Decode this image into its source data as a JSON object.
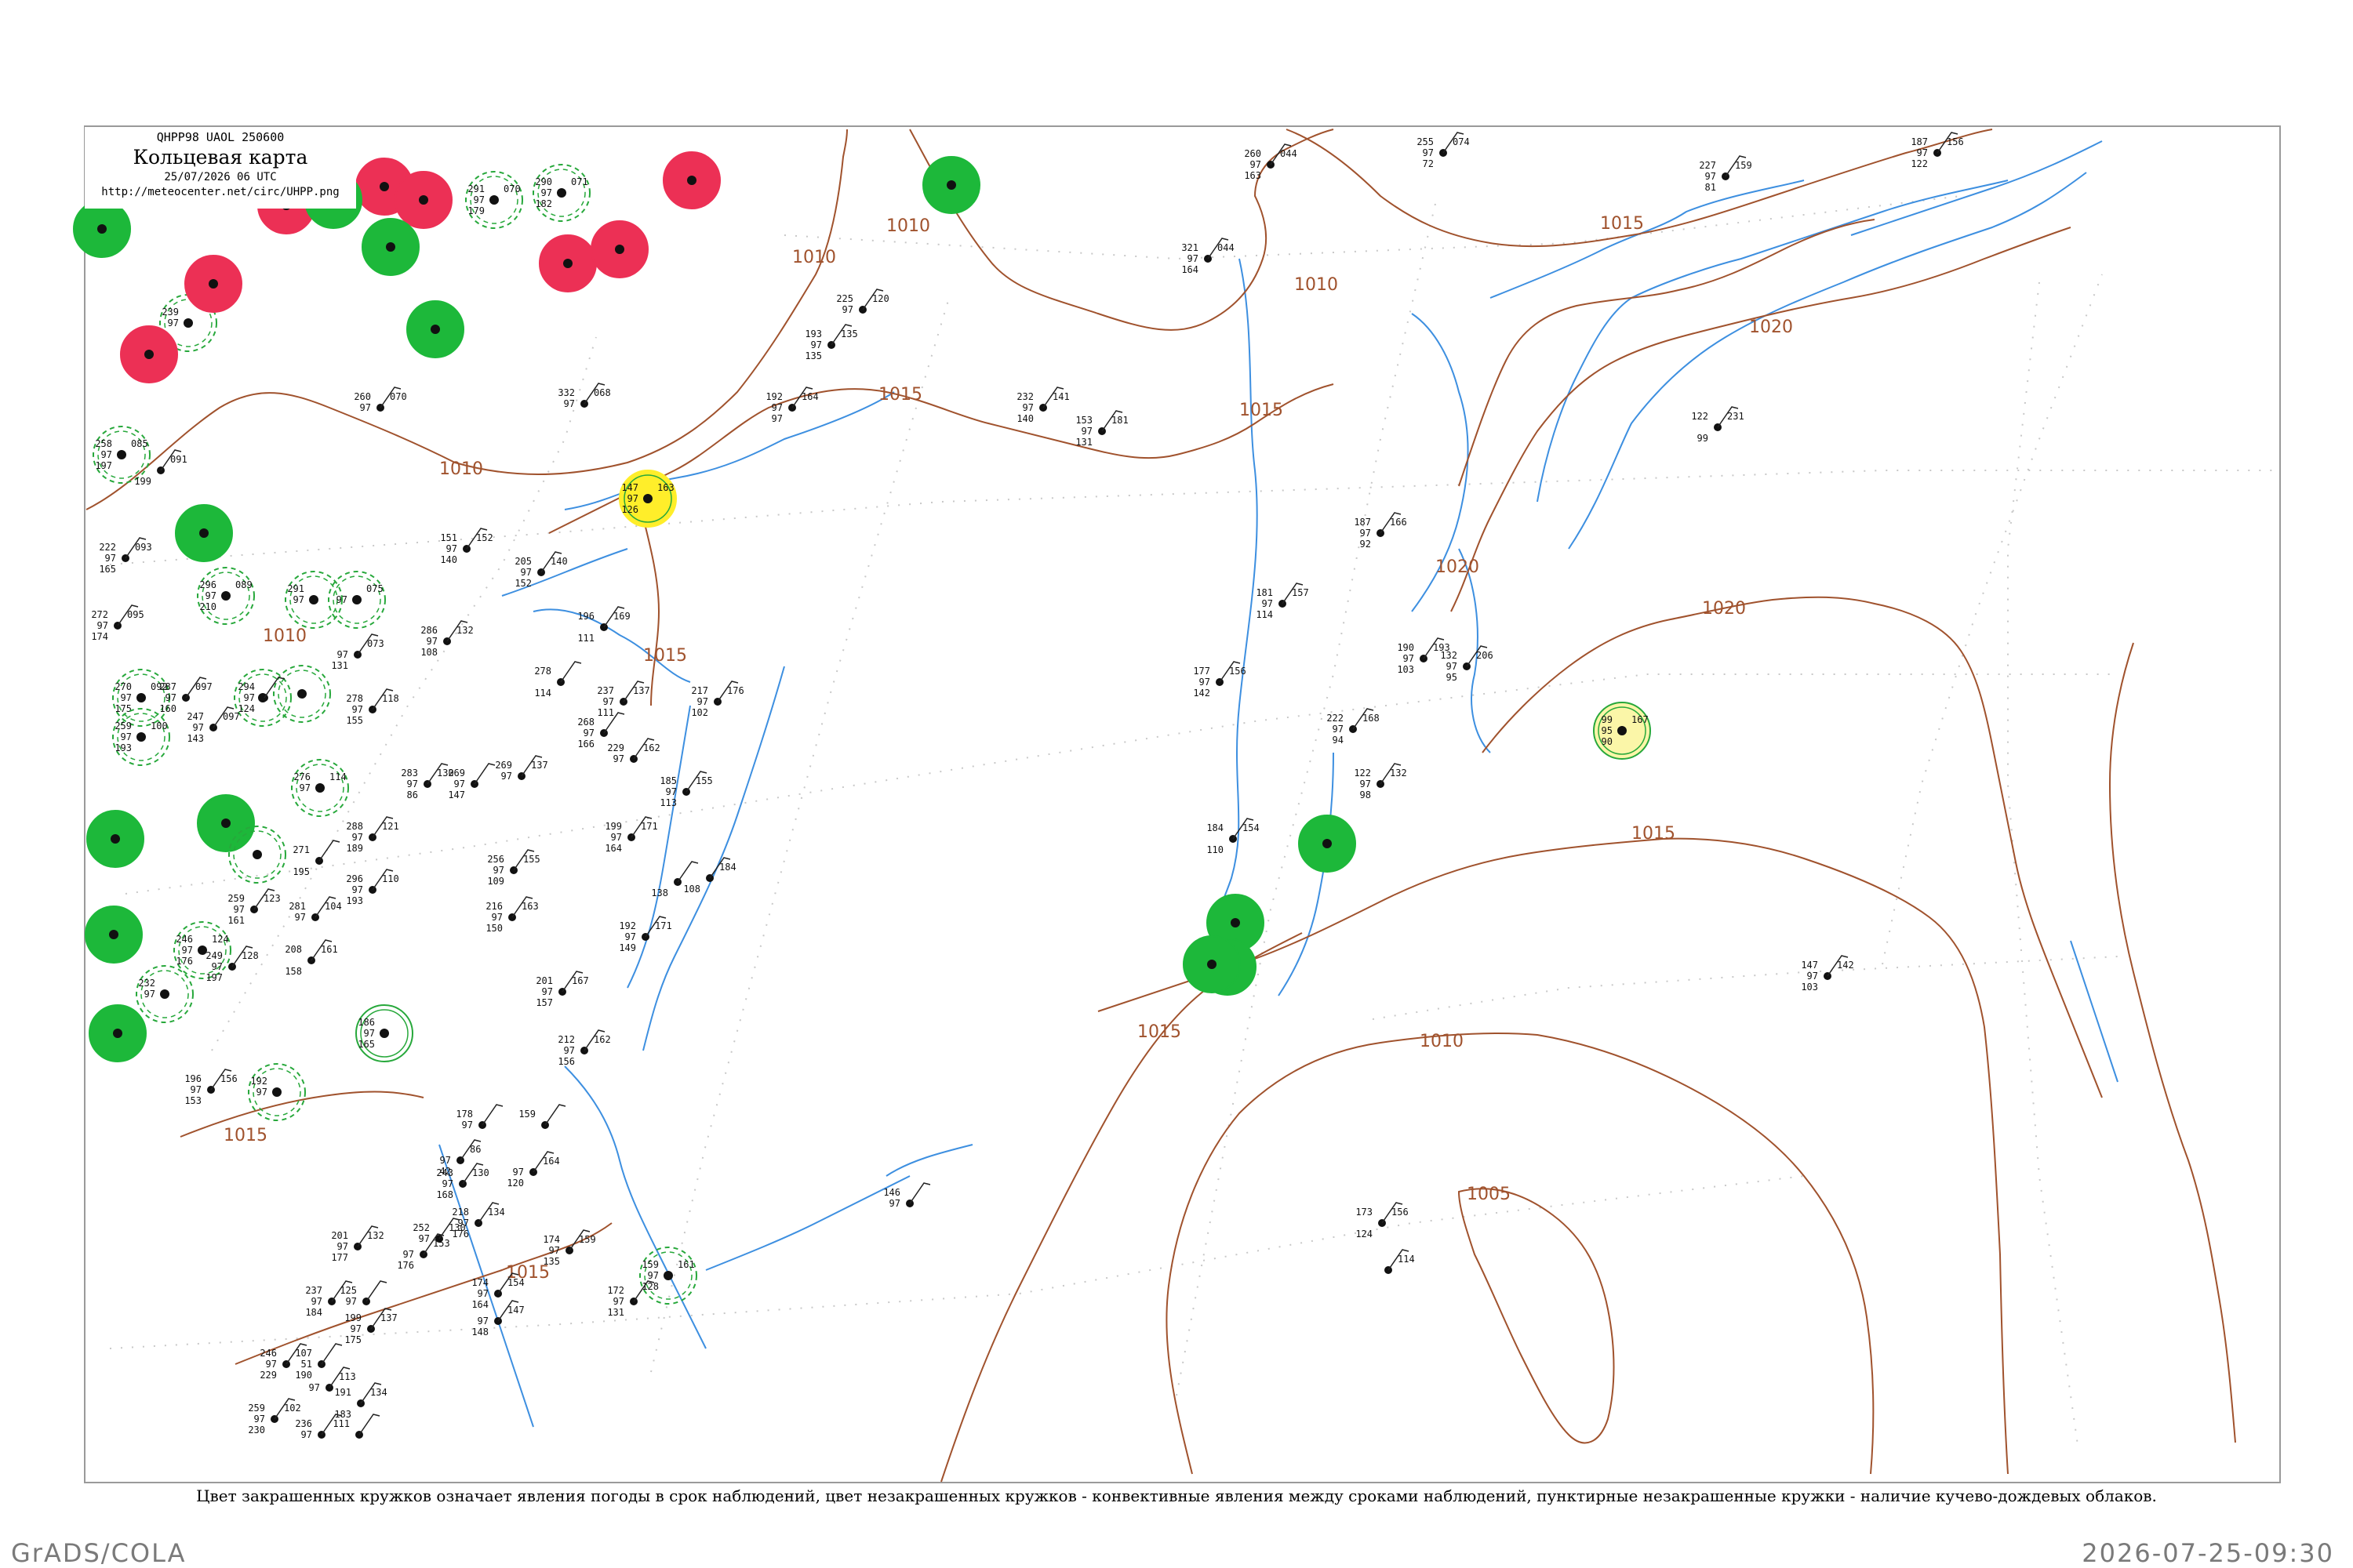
{
  "header": {
    "code": "QHPP98  UAOL  250600",
    "title": "Кольцевая карта",
    "date": "25/07/2026 06 UTC",
    "url": "http://meteocenter.net/circ/UHPP.png"
  },
  "caption": "Цвет закрашенных кружков означает явления погоды в срок наблюдений, цвет незакрашенных кружков - конвективные явления между сроками наблюдений, пунктирные незакрашенные кружки - наличие кучево-дождевых облаков.",
  "footer": {
    "left": "GrADS/COLA",
    "right": "2026-07-25-09:30"
  },
  "colors": {
    "isobar": "#a0522d",
    "water": "#3d8fe0",
    "green": "#1db83a",
    "red": "#ec3055",
    "yellow": "#ffee2a",
    "dashed": "#27a83b",
    "grid": "#c8c8c8",
    "frame": "#9a9a9a"
  },
  "isobar_labels": [
    {
      "text": "1010"
    },
    {
      "text": "1010"
    },
    {
      "text": "1010"
    },
    {
      "text": "1010"
    },
    {
      "text": "1015"
    },
    {
      "text": "1015"
    },
    {
      "text": "1015"
    },
    {
      "text": "1015"
    },
    {
      "text": "1020"
    },
    {
      "text": "1020"
    },
    {
      "text": "1020"
    },
    {
      "text": "1015"
    },
    {
      "text": "1015"
    },
    {
      "text": "1010"
    },
    {
      "text": "1005"
    },
    {
      "text": "1015"
    },
    {
      "text": "1015"
    },
    {
      "text": "1010"
    }
  ],
  "stations": [
    {
      "pr": "",
      "t": "",
      "td": "",
      "p3": "",
      "mark": "green-fill"
    },
    {
      "pr": "",
      "t": "",
      "td": "",
      "p3": "",
      "mark": "red-fill"
    },
    {
      "pr": "",
      "t": "",
      "td": "",
      "p3": "",
      "mark": "red-fill"
    },
    {
      "pr": "",
      "t": "",
      "td": "",
      "p3": "",
      "mark": "red-fill"
    },
    {
      "pr": "",
      "t": "",
      "td": "",
      "p3": "",
      "mark": "green-fill"
    },
    {
      "pr": "",
      "t": "",
      "td": "",
      "p3": "",
      "mark": "green-fill"
    },
    {
      "pr": "290",
      "t": "97",
      "td": "182",
      "p3": "071",
      "mark": "green-dash"
    },
    {
      "pr": "291",
      "t": "97",
      "td": "179",
      "p3": "070",
      "mark": "green-dash"
    },
    {
      "pr": "",
      "t": "",
      "td": "",
      "p3": "",
      "mark": "red-fill"
    },
    {
      "pr": "",
      "t": "",
      "td": "",
      "p3": "",
      "mark": "red-fill"
    },
    {
      "pr": "",
      "t": "",
      "td": "",
      "p3": "",
      "mark": "red-fill"
    },
    {
      "pr": "",
      "t": "",
      "td": "",
      "p3": "",
      "mark": "green-fill"
    },
    {
      "pr": "239",
      "t": "97",
      "td": "",
      "p3": "",
      "mark": "green-dash"
    },
    {
      "pr": "",
      "t": "",
      "td": "",
      "p3": "",
      "mark": "red-fill"
    },
    {
      "pr": "",
      "t": "",
      "td": "",
      "p3": "",
      "mark": "red-fill"
    },
    {
      "pr": "",
      "t": "",
      "td": "",
      "p3": "",
      "mark": "green-fill"
    },
    {
      "pr": "147",
      "t": "97",
      "td": "126",
      "p3": "163",
      "mark": "yellow-fill"
    },
    {
      "pr": "258",
      "t": "97",
      "td": "197",
      "p3": "085",
      "mark": "green-dash"
    },
    {
      "pr": "",
      "t": "",
      "td": "",
      "p3": "",
      "mark": "green-fill"
    },
    {
      "pr": "296",
      "t": "97",
      "td": "210",
      "p3": "089",
      "mark": "green-dash"
    },
    {
      "pr": "291",
      "t": "97",
      "td": "",
      "p3": "",
      "mark": "green-dash"
    },
    {
      "pr": "",
      "t": "97",
      "td": "",
      "p3": "075",
      "mark": "green-dash"
    },
    {
      "pr": "270",
      "t": "97",
      "td": "175",
      "p3": "092",
      "mark": "green-dash"
    },
    {
      "pr": "259",
      "t": "97",
      "td": "193",
      "p3": "100",
      "mark": "green-dash"
    },
    {
      "pr": "",
      "t": "",
      "td": "",
      "p3": "",
      "mark": "green-dash"
    },
    {
      "pr": "",
      "t": "",
      "td": "",
      "p3": "",
      "mark": "green-dash"
    },
    {
      "pr": "276",
      "t": "97",
      "td": "",
      "p3": "114",
      "mark": "green-dash"
    },
    {
      "pr": "",
      "t": "",
      "td": "",
      "p3": "",
      "mark": "green-fill"
    },
    {
      "pr": "",
      "t": "",
      "td": "",
      "p3": "",
      "mark": "green-fill"
    },
    {
      "pr": "",
      "t": "",
      "td": "",
      "p3": "",
      "mark": "green-dash"
    },
    {
      "pr": "",
      "t": "",
      "td": "",
      "p3": "",
      "mark": "green-fill"
    },
    {
      "pr": "246",
      "t": "97",
      "td": "176",
      "p3": "124",
      "mark": "green-dash"
    },
    {
      "pr": "232",
      "t": "97",
      "td": "",
      "p3": "",
      "mark": "green-dash"
    },
    {
      "pr": "",
      "t": "",
      "td": "",
      "p3": "",
      "mark": "green-fill"
    },
    {
      "pr": "186",
      "t": "97",
      "td": "165",
      "p3": "",
      "mark": "green-ring"
    },
    {
      "pr": "192",
      "t": "97",
      "td": "",
      "p3": "",
      "mark": "green-dash"
    },
    {
      "pr": "",
      "t": "",
      "td": "",
      "p3": "",
      "mark": "green-fill"
    },
    {
      "pr": "",
      "t": "",
      "td": "",
      "p3": "",
      "mark": "green-fill"
    },
    {
      "pr": "",
      "t": "",
      "td": "",
      "p3": "",
      "mark": "green-fill"
    },
    {
      "pr": "",
      "t": "",
      "td": "",
      "p3": "",
      "mark": "green-fill"
    },
    {
      "pr": "99",
      "t": "95",
      "td": "90",
      "p3": "167",
      "mark": "yellow-ring"
    },
    {
      "pr": "159",
      "t": "97",
      "td": "128",
      "p3": "161",
      "mark": "green-dash"
    }
  ],
  "plain_stations": [
    {
      "pr": "260",
      "t": "97",
      "td": "163",
      "p3": "044"
    },
    {
      "pr": "321",
      "t": "97",
      "td": "164",
      "p3": "044"
    },
    {
      "pr": "255",
      "t": "97",
      "td": "72",
      "p3": "074"
    },
    {
      "pr": "227",
      "t": "97",
      "td": "81",
      "p3": "159"
    },
    {
      "pr": "187",
      "t": "97",
      "td": "122",
      "p3": "156"
    },
    {
      "pr": "225",
      "t": "97",
      "td": "",
      "p3": "120"
    },
    {
      "pr": "193",
      "t": "97",
      "td": "135",
      "p3": "135"
    },
    {
      "pr": "192",
      "t": "97",
      "td": "97",
      "p3": "164"
    },
    {
      "pr": "232",
      "t": "97",
      "td": "140",
      "p3": "141"
    },
    {
      "pr": "153",
      "t": "97",
      "td": "131",
      "p3": "181"
    },
    {
      "pr": "122",
      "t": "",
      "td": "99",
      "p3": "231"
    },
    {
      "pr": "260",
      "t": "97",
      "td": "",
      "p3": "070"
    },
    {
      "pr": "332",
      "t": "97",
      "td": "",
      "p3": "068"
    },
    {
      "pr": "",
      "t": "",
      "td": "199",
      "p3": "091"
    },
    {
      "pr": "151",
      "t": "97",
      "td": "140",
      "p3": "152"
    },
    {
      "pr": "205",
      "t": "97",
      "td": "152",
      "p3": "140"
    },
    {
      "pr": "187",
      "t": "97",
      "td": "92",
      "p3": "166"
    },
    {
      "pr": "181",
      "t": "97",
      "td": "114",
      "p3": "157"
    },
    {
      "pr": "190",
      "t": "97",
      "td": "103",
      "p3": "193"
    },
    {
      "pr": "132",
      "t": "97",
      "td": "95",
      "p3": "206"
    },
    {
      "pr": "177",
      "t": "97",
      "td": "142",
      "p3": "156"
    },
    {
      "pr": "222",
      "t": "97",
      "td": "94",
      "p3": "168"
    },
    {
      "pr": "122",
      "t": "97",
      "td": "98",
      "p3": "132"
    },
    {
      "pr": "184",
      "t": "",
      "td": "110",
      "p3": "154"
    },
    {
      "pr": "222",
      "t": "97",
      "td": "165",
      "p3": "093"
    },
    {
      "pr": "272",
      "t": "97",
      "td": "174",
      "p3": "095"
    },
    {
      "pr": "286",
      "t": "97",
      "td": "108",
      "p3": "132"
    },
    {
      "pr": "",
      "t": "97",
      "td": "131",
      "p3": "073"
    },
    {
      "pr": "278",
      "t": "",
      "td": "114",
      "p3": ""
    },
    {
      "pr": "196",
      "t": "",
      "td": "111",
      "p3": "169"
    },
    {
      "pr": "237",
      "t": "97",
      "td": "111",
      "p3": "137"
    },
    {
      "pr": "217",
      "t": "97",
      "td": "102",
      "p3": "176"
    },
    {
      "pr": "287",
      "t": "97",
      "td": "160",
      "p3": "097"
    },
    {
      "pr": "294",
      "t": "97",
      "td": "124",
      "p3": ""
    },
    {
      "pr": "278",
      "t": "97",
      "td": "155",
      "p3": "118"
    },
    {
      "pr": "268",
      "t": "97",
      "td": "166",
      "p3": ""
    },
    {
      "pr": "229",
      "t": "97",
      "td": "",
      "p3": "162"
    },
    {
      "pr": "185",
      "t": "97",
      "td": "113",
      "p3": "155"
    },
    {
      "pr": "283",
      "t": "97",
      "td": "86",
      "p3": "130"
    },
    {
      "pr": "269",
      "t": "97",
      "td": "147",
      "p3": ""
    },
    {
      "pr": "269",
      "t": "97",
      "td": "",
      "p3": "137"
    },
    {
      "pr": "247",
      "t": "97",
      "td": "143",
      "p3": "097"
    },
    {
      "pr": "288",
      "t": "97",
      "td": "189",
      "p3": "121"
    },
    {
      "pr": "271",
      "t": "",
      "td": "195",
      "p3": ""
    },
    {
      "pr": "199",
      "t": "97",
      "td": "164",
      "p3": "171"
    },
    {
      "pr": "",
      "t": "",
      "td": "138",
      "p3": ""
    },
    {
      "pr": "",
      "t": "",
      "td": "108",
      "p3": "184"
    },
    {
      "pr": "256",
      "t": "97",
      "td": "109",
      "p3": "155"
    },
    {
      "pr": "296",
      "t": "97",
      "td": "193",
      "p3": "110"
    },
    {
      "pr": "259",
      "t": "97",
      "td": "161",
      "p3": "123"
    },
    {
      "pr": "281",
      "t": "97",
      "td": "",
      "p3": "104"
    },
    {
      "pr": "216",
      "t": "97",
      "td": "150",
      "p3": "163"
    },
    {
      "pr": "192",
      "t": "97",
      "td": "149",
      "p3": "171"
    },
    {
      "pr": "249",
      "t": "97",
      "td": "197",
      "p3": "128"
    },
    {
      "pr": "208",
      "t": "",
      "td": "158",
      "p3": "161"
    },
    {
      "pr": "201",
      "t": "97",
      "td": "157",
      "p3": "167"
    },
    {
      "pr": "212",
      "t": "97",
      "td": "156",
      "p3": "162"
    },
    {
      "pr": "196",
      "t": "97",
      "td": "153",
      "p3": "156"
    },
    {
      "pr": "178",
      "t": "97",
      "td": "",
      "p3": ""
    },
    {
      "pr": "159",
      "t": "",
      "td": "",
      "p3": ""
    },
    {
      "pr": "",
      "t": "97",
      "td": "42",
      "p3": "86"
    },
    {
      "pr": "243",
      "t": "97",
      "td": "168",
      "p3": "130"
    },
    {
      "pr": "",
      "t": "97",
      "td": "120",
      "p3": "164"
    },
    {
      "pr": "218",
      "t": "97",
      "td": "176",
      "p3": "134"
    },
    {
      "pr": "201",
      "t": "97",
      "td": "177",
      "p3": "132"
    },
    {
      "pr": "252",
      "t": "97",
      "td": "",
      "p3": "130"
    },
    {
      "pr": "",
      "t": "97",
      "td": "176",
      "p3": "153"
    },
    {
      "pr": "174",
      "t": "97",
      "td": "135",
      "p3": "159"
    },
    {
      "pr": "174",
      "t": "97",
      "td": "164",
      "p3": "154"
    },
    {
      "pr": "",
      "t": "97",
      "td": "148",
      "p3": "147"
    },
    {
      "pr": "237",
      "t": "97",
      "td": "184",
      "p3": ""
    },
    {
      "pr": "125",
      "t": "97",
      "td": "",
      "p3": ""
    },
    {
      "pr": "199",
      "t": "97",
      "td": "175",
      "p3": "137"
    },
    {
      "pr": "172",
      "t": "97",
      "td": "131",
      "p3": ""
    },
    {
      "pr": "146",
      "t": "97",
      "td": "",
      "p3": ""
    },
    {
      "pr": "246",
      "t": "97",
      "td": "229",
      "p3": ""
    },
    {
      "pr": "107",
      "t": "51",
      "td": "190",
      "p3": ""
    },
    {
      "pr": "",
      "t": "97",
      "td": "",
      "p3": "113"
    },
    {
      "pr": "191",
      "t": "",
      "td": "183",
      "p3": "134"
    },
    {
      "pr": "259",
      "t": "97",
      "td": "230",
      "p3": "102"
    },
    {
      "pr": "236",
      "t": "97",
      "td": "",
      "p3": ""
    },
    {
      "pr": "111",
      "t": "",
      "td": "",
      "p3": ""
    },
    {
      "pr": "173",
      "t": "",
      "td": "124",
      "p3": "156"
    },
    {
      "pr": "147",
      "t": "97",
      "td": "103",
      "p3": "142"
    },
    {
      "pr": "",
      "t": "",
      "td": "",
      "p3": "114"
    }
  ]
}
